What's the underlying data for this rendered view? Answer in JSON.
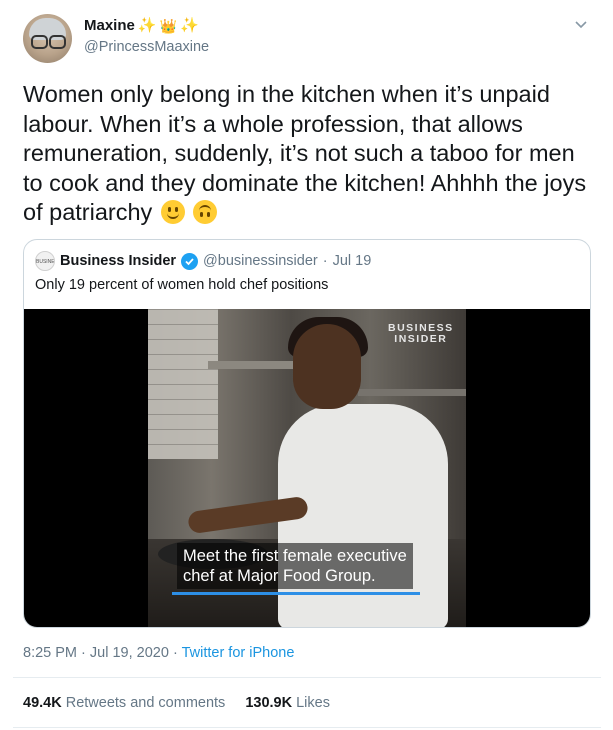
{
  "author": {
    "name": "Maxine",
    "name_emojis": [
      "✨",
      "👑",
      "✨"
    ],
    "handle": "@PrincessMaaxine",
    "avatar_icon": "profile-photo"
  },
  "menu_icon": "chevron-down-icon",
  "tweet": {
    "text": "Women only belong in the kitchen when it’s unpaid labour. When it’s a whole profession, that allows remuneration, suddenly, it’s not such a taboo for men to cook and they dominate the kitchen! Ahhhh the joys of patriarchy",
    "emojis": [
      "slightly-smiling-face",
      "upside-down-face"
    ]
  },
  "quoted": {
    "account_name": "Business Insider",
    "verified": true,
    "handle": "@businessinsider",
    "separator": "·",
    "date": "Jul 19",
    "text": "Only 19 percent of women hold chef positions",
    "logo_text": "BUSINESS INSIDER",
    "video": {
      "watermark_line1": "BUSINESS",
      "watermark_line2": "INSIDER",
      "caption_line1": "Meet the first female executive",
      "caption_line2": "chef at Major Food Group."
    }
  },
  "meta": {
    "time": "8:25 PM",
    "separator1": "·",
    "date": "Jul 19, 2020",
    "separator2": "·",
    "source": "Twitter for iPhone"
  },
  "stats": {
    "retweets_count": "49.4K",
    "retweets_label": "Retweets and comments",
    "likes_count": "130.9K",
    "likes_label": "Likes"
  },
  "colors": {
    "link": "#1b95e0",
    "verified": "#1da1f2",
    "secondary_text": "#657786",
    "border": "#ccd6dd"
  }
}
